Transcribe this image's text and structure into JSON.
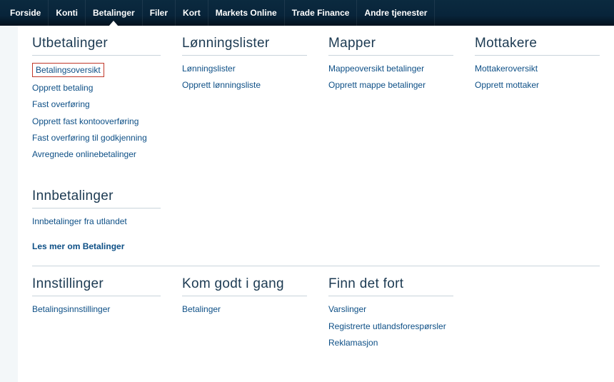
{
  "nav": {
    "tabs": [
      {
        "label": "Forside",
        "active": false
      },
      {
        "label": "Konti",
        "active": false
      },
      {
        "label": "Betalinger",
        "active": true
      },
      {
        "label": "Filer",
        "active": false
      },
      {
        "label": "Kort",
        "active": false
      },
      {
        "label": "Markets Online",
        "active": false
      },
      {
        "label": "Trade Finance",
        "active": false
      },
      {
        "label": "Andre tjenester",
        "active": false
      }
    ]
  },
  "sections": {
    "utbetalinger": {
      "title": "Utbetalinger",
      "links": [
        {
          "label": "Betalingsoversikt",
          "highlight": true
        },
        {
          "label": "Opprett betaling"
        },
        {
          "label": "Fast overføring"
        },
        {
          "label": "Opprett fast kontooverføring"
        },
        {
          "label": "Fast overføring til godkjenning"
        },
        {
          "label": "Avregnede onlinebetalinger"
        }
      ]
    },
    "lonningslister": {
      "title": "Lønningslister",
      "links": [
        {
          "label": "Lønningslister"
        },
        {
          "label": "Opprett lønningsliste"
        }
      ]
    },
    "mapper": {
      "title": "Mapper",
      "links": [
        {
          "label": "Mappeoversikt betalinger"
        },
        {
          "label": "Opprett mappe betalinger"
        }
      ]
    },
    "mottakere": {
      "title": "Mottakere",
      "links": [
        {
          "label": "Mottakeroversikt"
        },
        {
          "label": "Opprett mottaker"
        }
      ]
    },
    "innbetalinger": {
      "title": "Innbetalinger",
      "links": [
        {
          "label": "Innbetalinger fra utlandet"
        }
      ]
    },
    "more_link": "Les mer om Betalinger",
    "innstillinger": {
      "title": "Innstillinger",
      "links": [
        {
          "label": "Betalingsinnstillinger"
        }
      ]
    },
    "komgodt": {
      "title": "Kom godt i gang",
      "links": [
        {
          "label": "Betalinger"
        }
      ]
    },
    "finndetfort": {
      "title": "Finn det fort",
      "links": [
        {
          "label": "Varslinger"
        },
        {
          "label": "Registrerte utlandsforespørsler"
        },
        {
          "label": "Reklamasjon"
        }
      ]
    }
  }
}
